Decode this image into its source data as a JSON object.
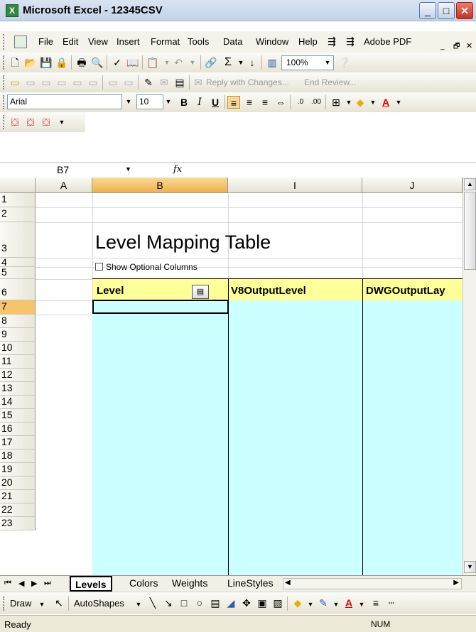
{
  "window": {
    "title": "Microsoft Excel - 12345CSV",
    "app_icon": "X"
  },
  "menu": {
    "items": [
      "File",
      "Edit",
      "View",
      "Insert",
      "Format",
      "Tools",
      "Data",
      "Window",
      "Help",
      "Adobe PDF"
    ]
  },
  "toolbar": {
    "zoom": "100%",
    "reply_with_changes": "Reply with Changes...",
    "end_review": "End Review..."
  },
  "format_bar": {
    "font": "Arial",
    "size": "10"
  },
  "formula_bar": {
    "name_box": "B7",
    "fx": "fx"
  },
  "columns": [
    "A",
    "B",
    "I",
    "J"
  ],
  "rows": [
    "1",
    "2",
    "3",
    "4",
    "5",
    "6",
    "7",
    "8",
    "9",
    "10",
    "11",
    "12",
    "13",
    "14",
    "15",
    "16",
    "17",
    "18",
    "19",
    "20",
    "21",
    "22",
    "23"
  ],
  "sheet": {
    "title": "Level Mapping Table",
    "checkbox_label": "Show Optional Columns",
    "headers": [
      "Level",
      "V8OutputLevel",
      "DWGOutputLay"
    ]
  },
  "tabs": {
    "items": [
      "Levels",
      "Colors",
      "Weights",
      "LineStyles"
    ],
    "active": "Levels"
  },
  "drawing": {
    "draw_label": "Draw",
    "autoshapes_label": "AutoShapes"
  },
  "status": {
    "left": "Ready",
    "num": "NUM"
  },
  "colors": {
    "header_yellow": "#ffff99",
    "data_cyan": "#ccffff",
    "selected_header": "#f6c46a"
  }
}
